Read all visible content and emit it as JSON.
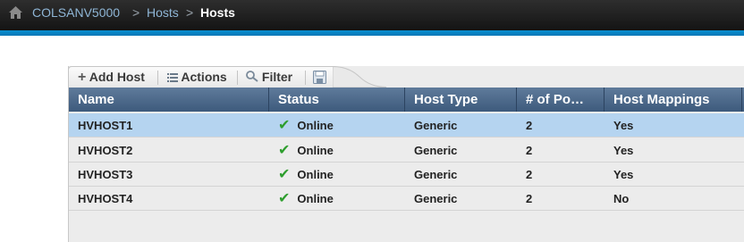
{
  "breadcrumb": {
    "root": "COLSANV5000",
    "section": "Hosts",
    "current": "Hosts",
    "separator": ">"
  },
  "toolbar": {
    "add_host": "Add Host",
    "actions": "Actions",
    "filter": "Filter"
  },
  "table": {
    "columns": [
      "Name",
      "Status",
      "Host Type",
      "# of Po…",
      "Host Mappings"
    ],
    "rows": [
      {
        "name": "HVHOST1",
        "status": "Online",
        "host_type": "Generic",
        "ports": "2",
        "mappings": "Yes"
      },
      {
        "name": "HVHOST2",
        "status": "Online",
        "host_type": "Generic",
        "ports": "2",
        "mappings": "Yes"
      },
      {
        "name": "HVHOST3",
        "status": "Online",
        "host_type": "Generic",
        "ports": "2",
        "mappings": "Yes"
      },
      {
        "name": "HVHOST4",
        "status": "Online",
        "host_type": "Generic",
        "ports": "2",
        "mappings": "No"
      }
    ],
    "selected_row": 1
  },
  "colors": {
    "topbar": "#1f1f1f",
    "accent_stripe": "#0a8fd0",
    "header": "#4a6788",
    "selected_row": "#b5d4f0",
    "status_ok": "#2e9e2e"
  }
}
